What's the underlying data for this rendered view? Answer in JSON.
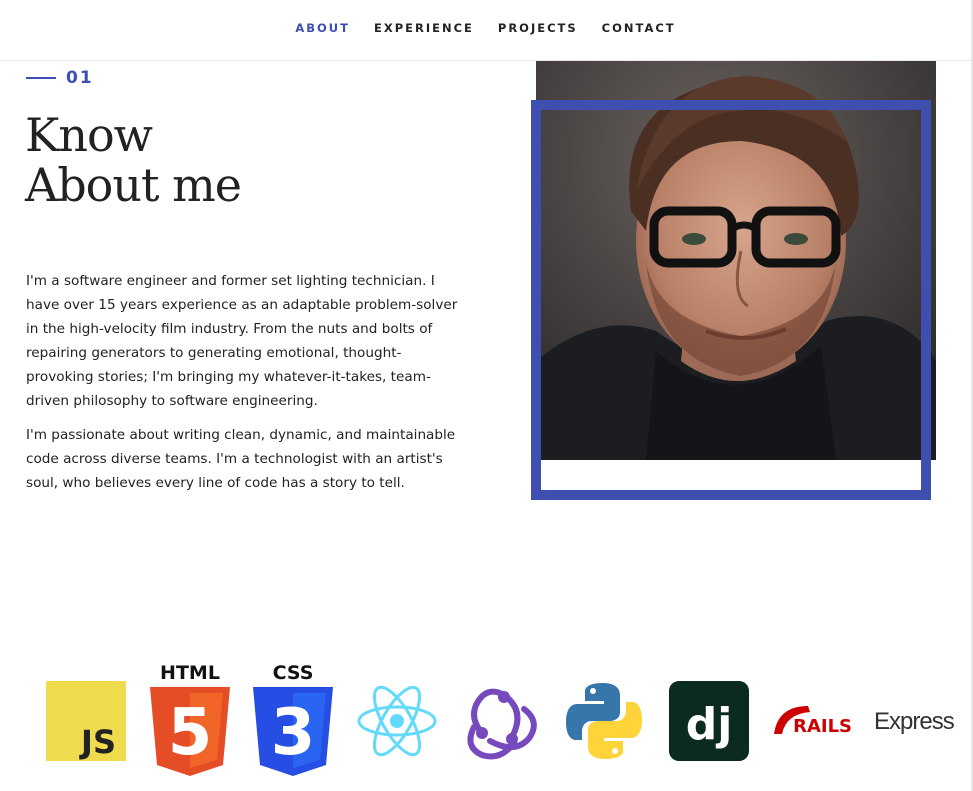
{
  "nav": {
    "items": [
      {
        "label": "ABOUT",
        "active": true
      },
      {
        "label": "EXPERIENCE",
        "active": false
      },
      {
        "label": "PROJECTS",
        "active": false
      },
      {
        "label": "CONTACT",
        "active": false
      }
    ]
  },
  "about": {
    "section_number": "01",
    "heading_line1": "Know",
    "heading_line2": "About me",
    "paragraph1": "I'm a software engineer and former set lighting technician. I have over 15 years experience as an adaptable problem-solver in the high-velocity film industry. From the nuts and bolts of repairing generators to generating emotional, thought-provoking stories; I'm bringing my whatever-it-takes, team-driven philosophy to software engineering.",
    "paragraph2": "I'm passionate about writing clean, dynamic, and maintainable code across diverse teams. I'm a technologist with an artist's soul, who believes every line of code has a story to tell."
  },
  "skills": {
    "js_label": "JS",
    "html_label": "HTML",
    "html_digit": "5",
    "css_label": "CSS",
    "css_digit": "3",
    "django_label": "dj",
    "rails_label": "RAILS",
    "express_label": "Express"
  },
  "colors": {
    "accent": "#3f4fb0",
    "js_yellow": "#f0db4f",
    "html_orange": "#e44d26",
    "css_blue": "#264de4",
    "react_cyan": "#61dafb",
    "redux_purple": "#764abc",
    "django_green": "#0c2b1f",
    "rails_red": "#cc0000"
  }
}
